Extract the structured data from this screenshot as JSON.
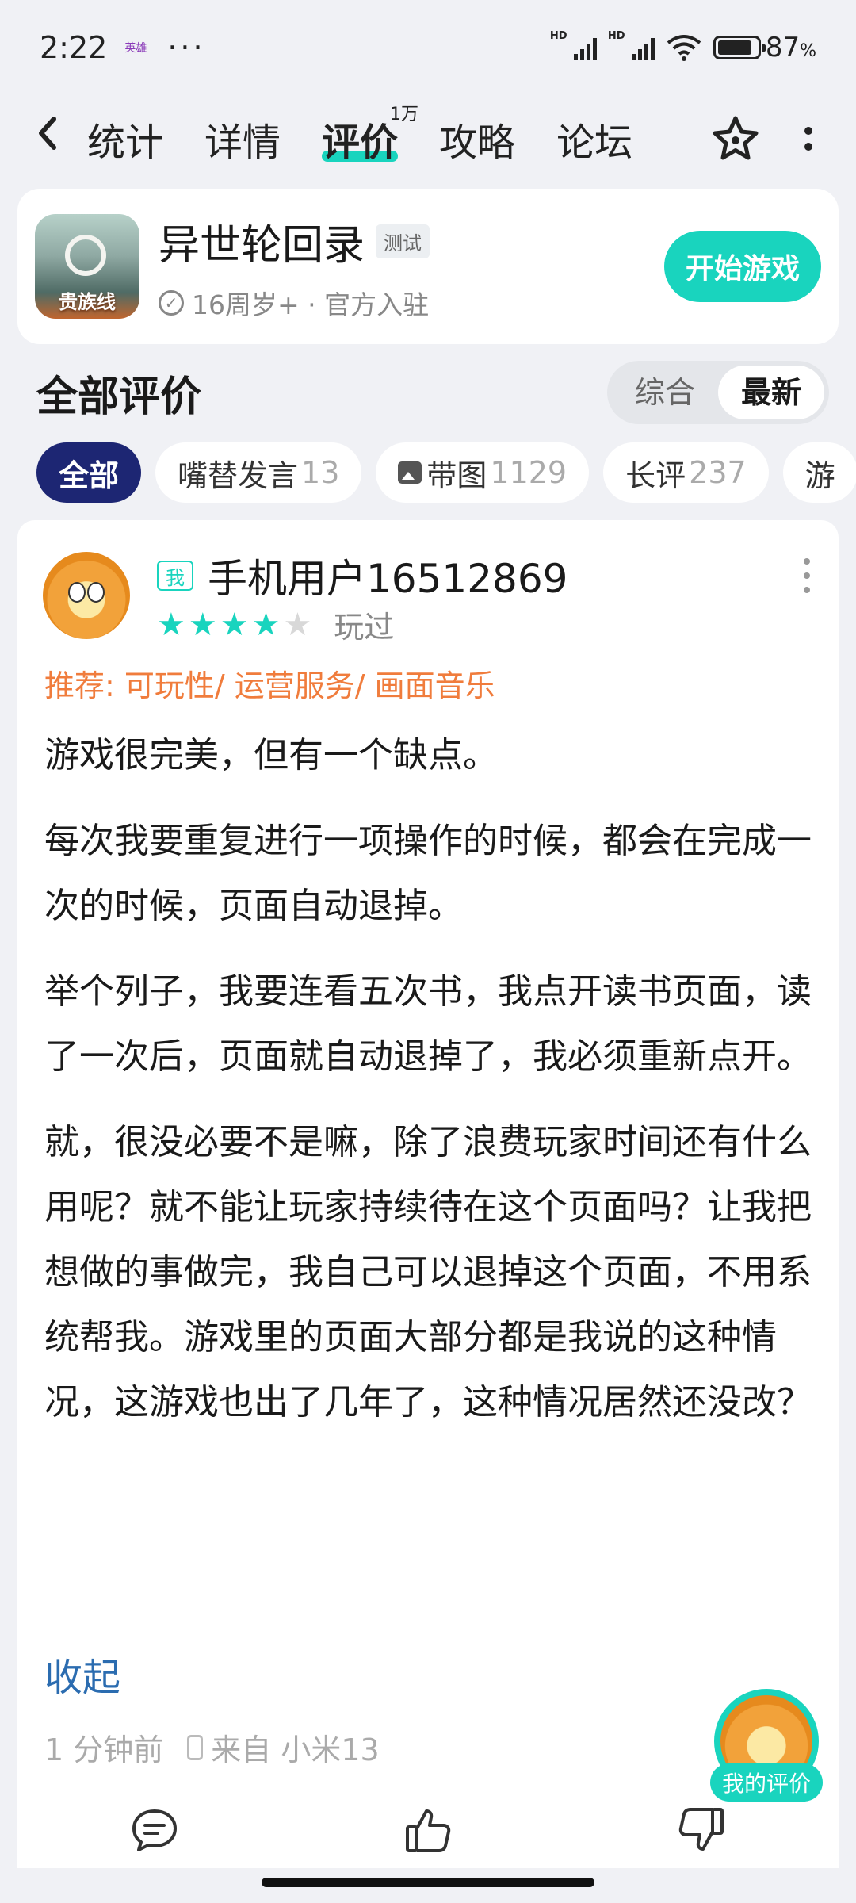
{
  "status_bar": {
    "time": "2:22",
    "app_mini_label": "英雄",
    "more": "···",
    "battery_percent": 87,
    "battery_text": "87",
    "battery_unit": "%",
    "hd_label": "HD"
  },
  "nav": {
    "tabs": [
      {
        "label": "统计"
      },
      {
        "label": "详情"
      },
      {
        "label": "评价",
        "badge": "1万"
      },
      {
        "label": "攻略"
      },
      {
        "label": "论坛"
      }
    ],
    "active_tab": "评价"
  },
  "game": {
    "title": "异世轮回录",
    "tag": "测试",
    "icon_text": "贵族线",
    "subtitle": "16周岁+ · 官方入驻",
    "play_button": "开始游戏"
  },
  "reviews_section": {
    "title": "全部评价",
    "sort_options": [
      "综合",
      "最新"
    ],
    "sort_selected": "最新"
  },
  "filters": [
    {
      "label": "全部",
      "count": ""
    },
    {
      "label": "嘴替发言",
      "count": "13"
    },
    {
      "label": "带图",
      "count": "1129"
    },
    {
      "label": "长评",
      "count": "237"
    },
    {
      "label": "游",
      "count": ""
    }
  ],
  "review": {
    "me_badge": "我",
    "username": "手机用户16512869",
    "rating": 4,
    "rating_max": 5,
    "status": "玩过",
    "recommend": "推荐: 可玩性/ 运营服务/ 画面音乐",
    "paragraphs": [
      "游戏很完美，但有一个缺点。",
      "每次我要重复进行一项操作的时候，都会在完成一次的时候，页面自动退掉。",
      "举个列子，我要连看五次书，我点开读书页面，读了一次后，页面就自动退掉了，我必须重新点开。",
      "就，很没必要不是嘛，除了浪费玩家时间还有什么用呢？就不能让玩家持续待在这个页面吗？让我把想做的事做完，我自己可以退掉这个页面，不用系统帮我。游戏里的页面大部分都是我说的这种情况，这游戏也出了几年了，这种情况居然还没改？"
    ],
    "collapse_label": "收起",
    "time_ago": "1 分钟前",
    "device": "来自 小米13"
  },
  "floating": {
    "my_review_label": "我的评价"
  },
  "colors": {
    "accent": "#19d4be",
    "active_chip": "#1d2673",
    "recommend": "#f07c3c",
    "link": "#2b6cb0"
  }
}
